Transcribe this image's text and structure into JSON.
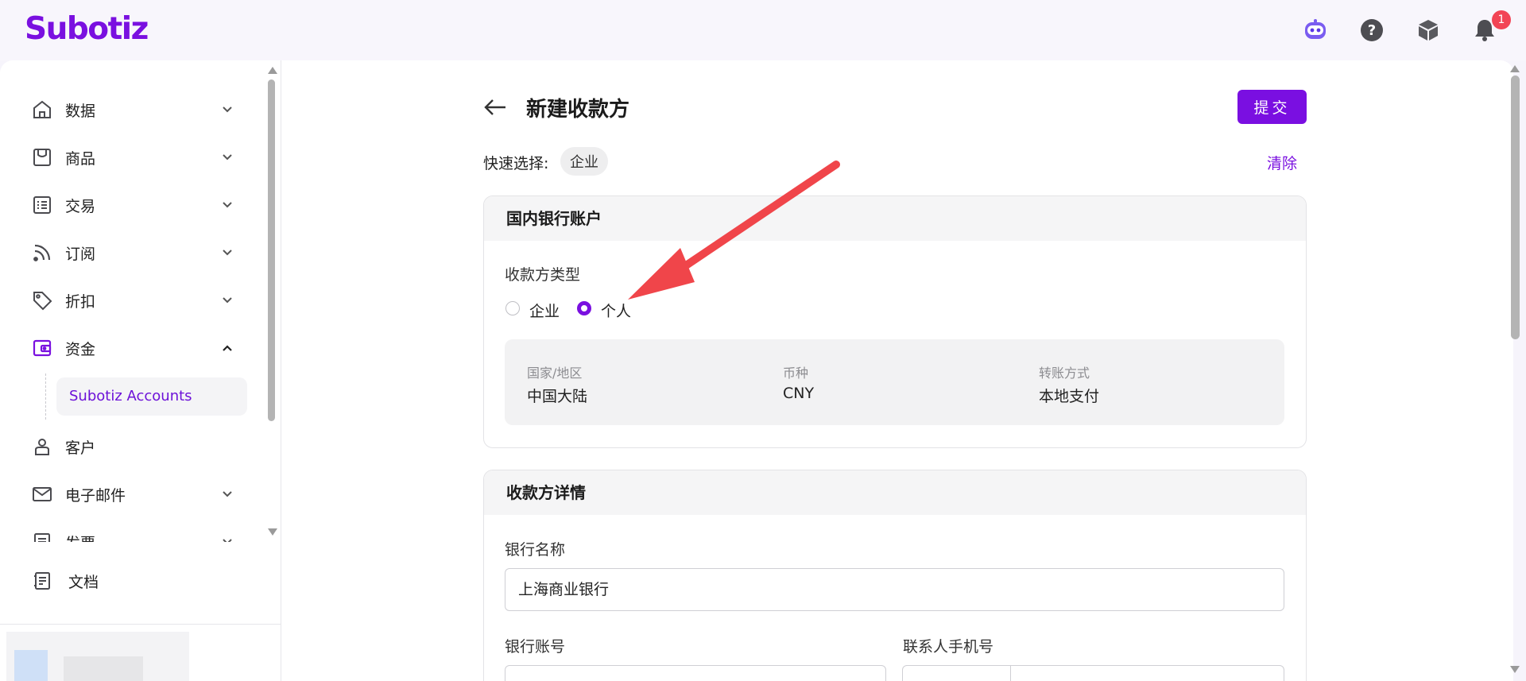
{
  "app": {
    "logo_text": "Subotiz",
    "brand_color": "#7a10e0",
    "notification_count": "1",
    "top_icons": [
      "assistant-bot-icon",
      "help-icon",
      "package-icon",
      "bell-icon"
    ]
  },
  "sidebar": {
    "items": [
      {
        "label": "数据",
        "icon": "home-icon",
        "expandable": true,
        "expanded": false
      },
      {
        "label": "商品",
        "icon": "store-icon",
        "expandable": true,
        "expanded": false
      },
      {
        "label": "交易",
        "icon": "list-icon",
        "expandable": true,
        "expanded": false
      },
      {
        "label": "订阅",
        "icon": "rss-icon",
        "expandable": true,
        "expanded": false
      },
      {
        "label": "折扣",
        "icon": "tag-icon",
        "expandable": true,
        "expanded": false
      },
      {
        "label": "资金",
        "icon": "wallet-icon",
        "expandable": true,
        "expanded": true
      },
      {
        "label": "客户",
        "icon": "user-icon",
        "expandable": false
      },
      {
        "label": "电子邮件",
        "icon": "mail-icon",
        "expandable": true,
        "expanded": false
      },
      {
        "label": "发票",
        "icon": "invoice-icon",
        "expandable": true,
        "expanded": false
      }
    ],
    "sub_item": "Subotiz Accounts",
    "footer_item": "文档"
  },
  "page": {
    "title": "新建收款方",
    "submit_label": "提交",
    "quick_select_label": "快速选择:",
    "quick_select_chip": "企业",
    "clear_label": "清除"
  },
  "bank_card": {
    "title": "国内银行账户",
    "payee_type_label": "收款方类型",
    "options": [
      "企业",
      "个人"
    ],
    "selected_option": "个人",
    "info": [
      {
        "key": "国家/地区",
        "value": "中国大陆"
      },
      {
        "key": "币种",
        "value": "CNY"
      },
      {
        "key": "转账方式",
        "value": "本地支付"
      }
    ]
  },
  "details_card": {
    "title": "收款方详情",
    "bank_name_label": "银行名称",
    "bank_name_value": "上海商业银行",
    "account_label": "银行账号",
    "phone_label": "联系人手机号"
  }
}
